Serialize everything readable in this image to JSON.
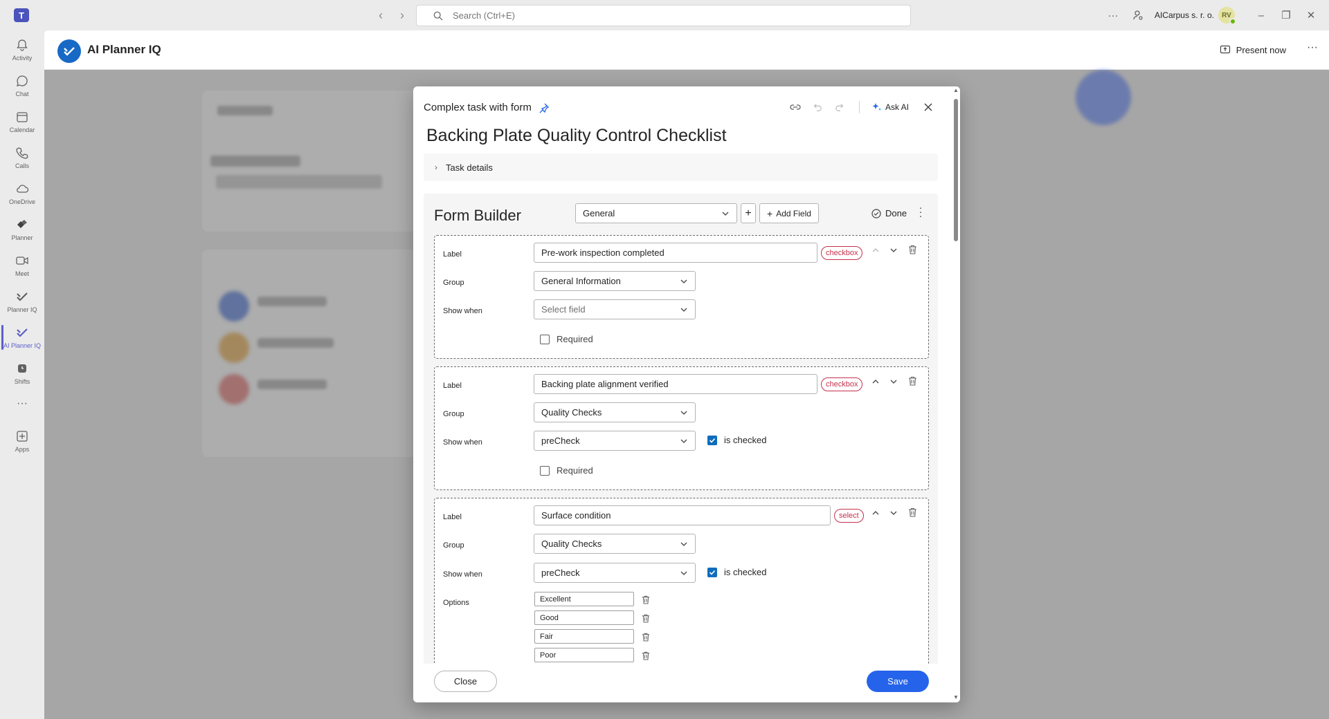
{
  "titlebar": {
    "search_placeholder": "Search (Ctrl+E)",
    "org_name": "AICarpus s. r. o.",
    "avatar_initials": "RV"
  },
  "rail": [
    {
      "label": "Activity",
      "icon": "bell-icon"
    },
    {
      "label": "Chat",
      "icon": "chat-icon"
    },
    {
      "label": "Calendar",
      "icon": "calendar-icon"
    },
    {
      "label": "Calls",
      "icon": "phone-icon"
    },
    {
      "label": "OneDrive",
      "icon": "cloud-icon"
    },
    {
      "label": "Planner",
      "icon": "planner-icon"
    },
    {
      "label": "Meet",
      "icon": "video-icon"
    },
    {
      "label": "Planner IQ",
      "icon": "planner-iq-icon"
    },
    {
      "label": "AI Planner IQ",
      "icon": "ai-planner-iq-icon",
      "active": true
    },
    {
      "label": "Shifts",
      "icon": "shifts-icon"
    },
    {
      "label": "",
      "icon": "more-apps-icon"
    },
    {
      "label": "Apps",
      "icon": "add-apps-icon"
    }
  ],
  "app": {
    "title": "AI Planner IQ",
    "present_now": "Present now"
  },
  "dialog": {
    "header": "Complex task with form",
    "ask_ai": "Ask AI",
    "title": "Backing Plate Quality Control Checklist",
    "task_details": "Task details",
    "form_builder": {
      "title": "Form Builder",
      "group_select": "General",
      "add_field": "Add Field",
      "done": "Done"
    },
    "labels": {
      "label": "Label",
      "group": "Group",
      "show_when": "Show when",
      "required": "Required",
      "options": "Options",
      "is_checked": "is checked"
    },
    "fields": [
      {
        "label": "Pre-work inspection completed",
        "type": "checkbox",
        "group": "General Information",
        "show_when": "Select field",
        "show_when_placeholder": true,
        "required": false
      },
      {
        "label": "Backing plate alignment verified",
        "type": "checkbox",
        "group": "Quality Checks",
        "show_when": "preCheck",
        "is_checked": true,
        "required": false
      },
      {
        "label": "Surface condition",
        "type": "select",
        "group": "Quality Checks",
        "show_when": "preCheck",
        "is_checked": true,
        "options": [
          "Excellent",
          "Good",
          "Fair",
          "Poor"
        ]
      }
    ],
    "footer": {
      "close": "Close",
      "save": "Save"
    }
  },
  "colors": {
    "accent": "#2563eb",
    "badge": "#c4314b",
    "rail_active": "#5b5fc7"
  }
}
